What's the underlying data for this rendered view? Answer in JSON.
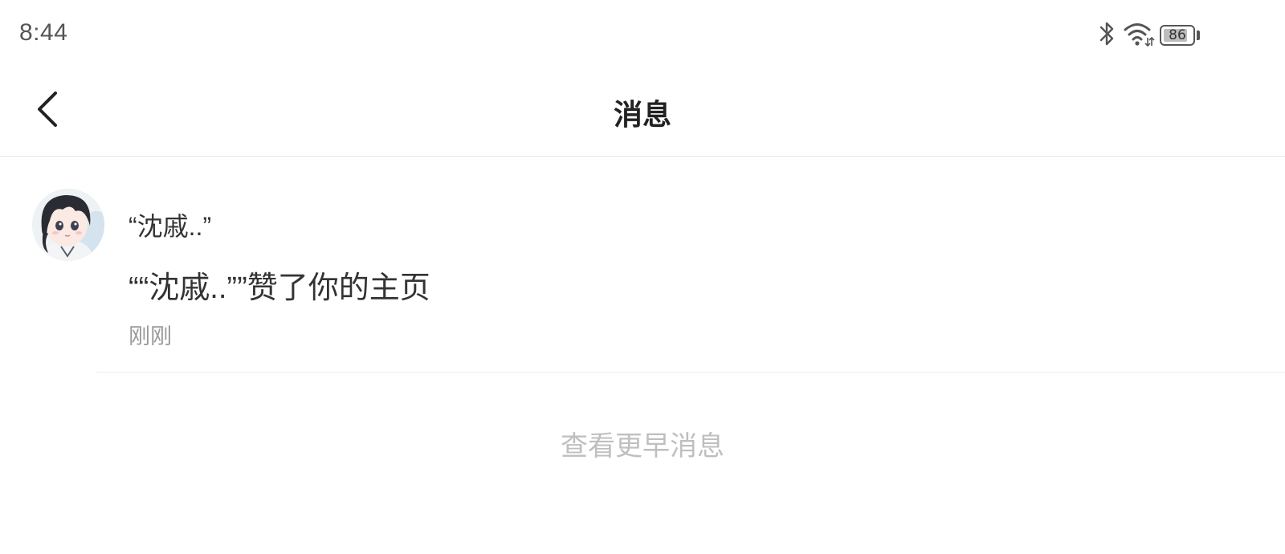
{
  "status_bar": {
    "time": "8:44",
    "battery_level": "86",
    "battery_fraction": 0.86,
    "icons": [
      "bluetooth-icon",
      "wifi-icon",
      "battery-icon"
    ]
  },
  "nav": {
    "title": "消息",
    "back_icon": "chevron-left-icon"
  },
  "messages": [
    {
      "sender": "“沈戚..”",
      "content": "““沈戚..””赞了你的主页",
      "time": "刚刚"
    }
  ],
  "load_more_label": "查看更早消息",
  "colors": {
    "text_primary": "#222222",
    "text_secondary": "#999999",
    "text_muted": "#bfbfbf",
    "divider": "#e6e6e6"
  }
}
